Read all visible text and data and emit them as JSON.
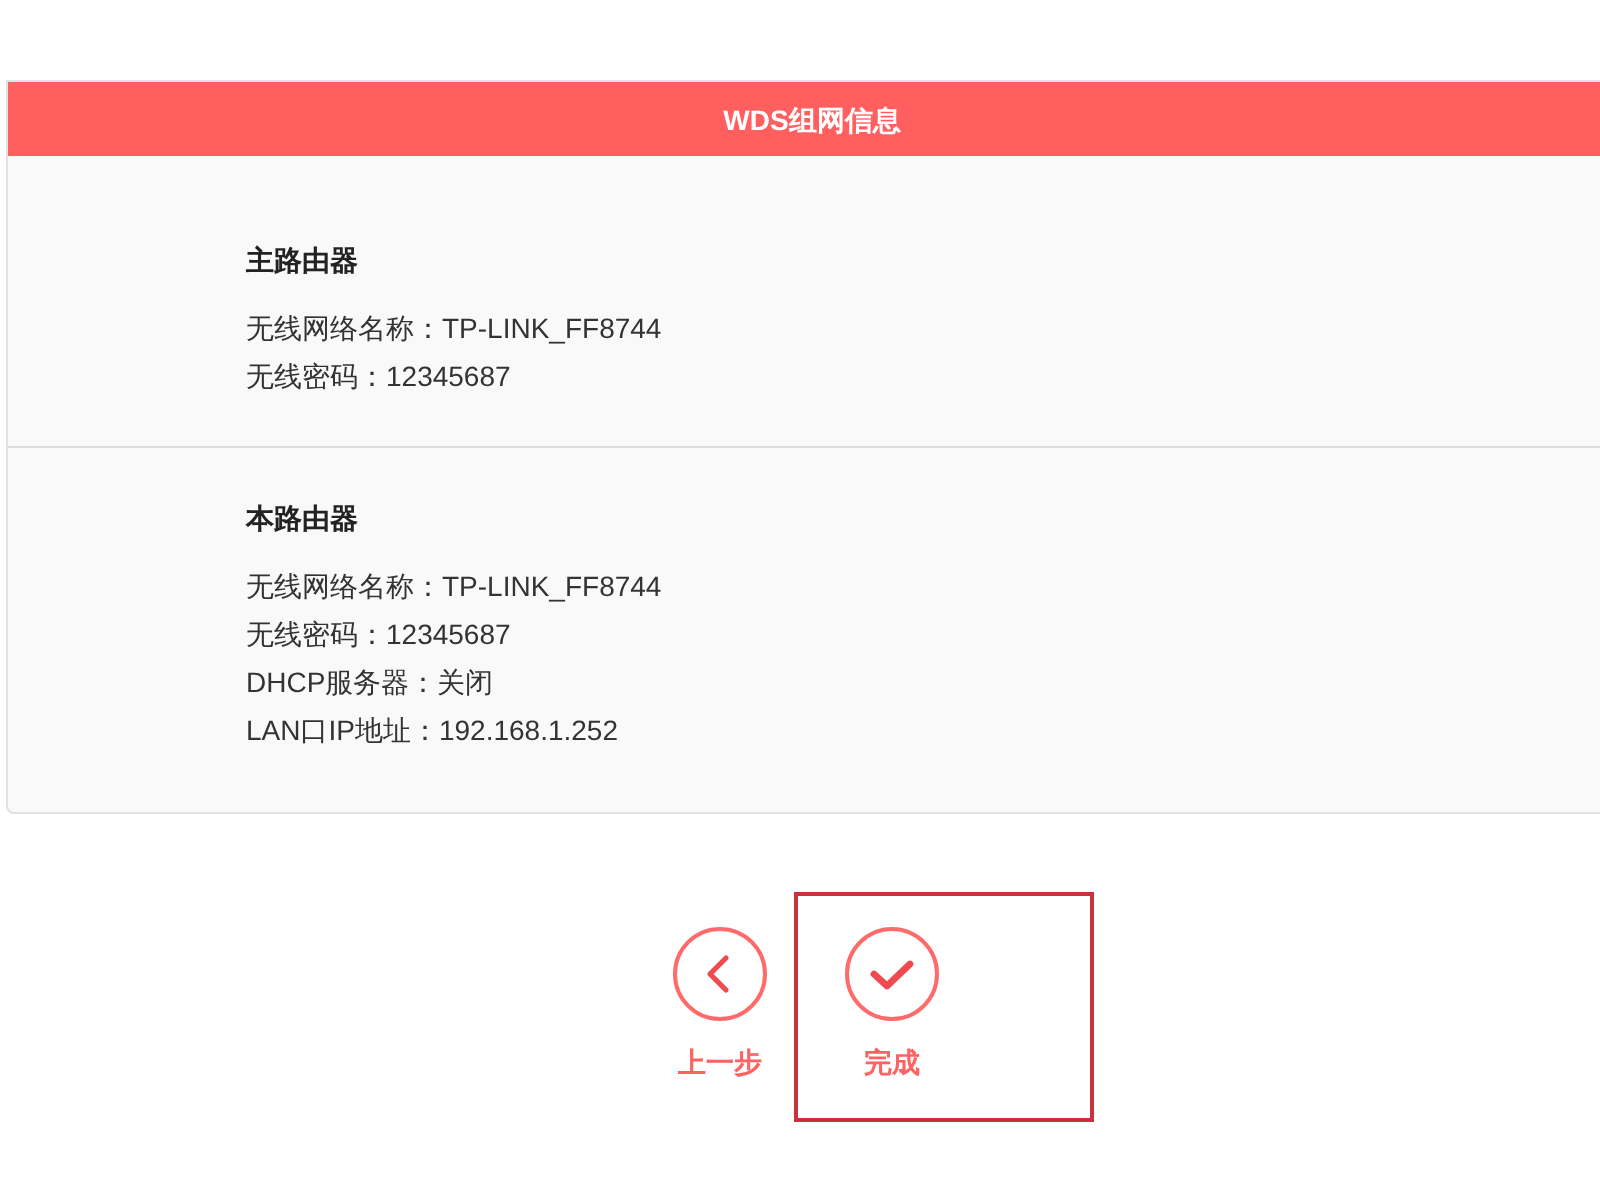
{
  "card": {
    "title": "WDS组网信息",
    "sections": [
      {
        "heading": "主路由器",
        "lines": [
          "无线网络名称：TP-LINK_FF8744",
          "无线密码：12345687"
        ]
      },
      {
        "heading": "本路由器",
        "lines": [
          "无线网络名称：TP-LINK_FF8744",
          "无线密码：12345687",
          "DHCP服务器：关闭",
          "LAN口IP地址：192.168.1.252"
        ]
      }
    ]
  },
  "buttons": [
    {
      "kind": "back",
      "label": "上一步",
      "highlighted": false
    },
    {
      "kind": "finish",
      "label": "完成",
      "highlighted": true
    }
  ]
}
